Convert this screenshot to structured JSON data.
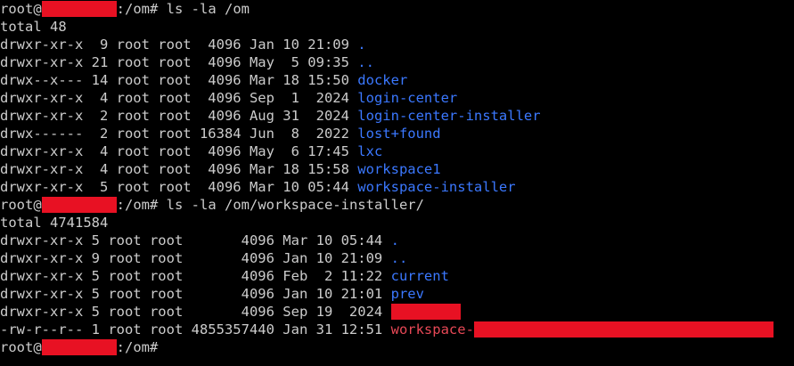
{
  "terminal": {
    "prompt_user": "root@",
    "prompt_suffix_1": ":/om# ",
    "command_1": "ls -la /om",
    "total_1": "total 48",
    "listing_1": [
      {
        "meta": "drwxr-xr-x  9 root root  4096 Jan 10 21:09 ",
        "name": ".",
        "type": "dir"
      },
      {
        "meta": "drwxr-xr-x 21 root root  4096 May  5 09:35 ",
        "name": "..",
        "type": "dir"
      },
      {
        "meta": "drwx--x--- 14 root root  4096 Mar 18 15:50 ",
        "name": "docker",
        "type": "dir"
      },
      {
        "meta": "drwxr-xr-x  4 root root  4096 Sep  1  2024 ",
        "name": "login-center",
        "type": "dir"
      },
      {
        "meta": "drwxr-xr-x  2 root root  4096 Aug 31  2024 ",
        "name": "login-center-installer",
        "type": "dir"
      },
      {
        "meta": "drwx------  2 root root 16384 Jun  8  2022 ",
        "name": "lost+found",
        "type": "dir"
      },
      {
        "meta": "drwxr-xr-x  4 root root  4096 May  6 17:45 ",
        "name": "lxc",
        "type": "dir"
      },
      {
        "meta": "drwxr-xr-x  4 root root  4096 Mar 18 15:58 ",
        "name": "workspace1",
        "type": "dir"
      },
      {
        "meta": "drwxr-xr-x  5 root root  4096 Mar 10 05:44 ",
        "name": "workspace-installer",
        "type": "dir"
      }
    ],
    "prompt_suffix_2": ":/om# ",
    "command_2": "ls -la /om/workspace-installer/",
    "total_2": "total 4741584",
    "listing_2": [
      {
        "meta": "drwxr-xr-x 5 root root       4096 Mar 10 05:44 ",
        "name": ".",
        "type": "dir"
      },
      {
        "meta": "drwxr-xr-x 9 root root       4096 Jan 10 21:09 ",
        "name": "..",
        "type": "dir"
      },
      {
        "meta": "drwxr-xr-x 5 root root       4096 Feb  2 11:22 ",
        "name": "current",
        "type": "dir"
      },
      {
        "meta": "drwxr-xr-x 5 root root       4096 Jan 10 21:01 ",
        "name": "prev",
        "type": "dir"
      },
      {
        "meta": "drwxr-xr-x 5 root root       4096 Sep 19  2024 ",
        "name": "",
        "type": "dir-redacted"
      },
      {
        "meta": "-rw-r--r-- 1 root root 4855357440 Jan 31 12:51 ",
        "name": "workspace-",
        "type": "archive-redacted"
      }
    ],
    "prompt_suffix_3": ":/om# "
  },
  "colors": {
    "background": "#000000",
    "text": "#cccccc",
    "directory": "#3b78ff",
    "archive": "#e74856",
    "redaction": "#e81123"
  }
}
